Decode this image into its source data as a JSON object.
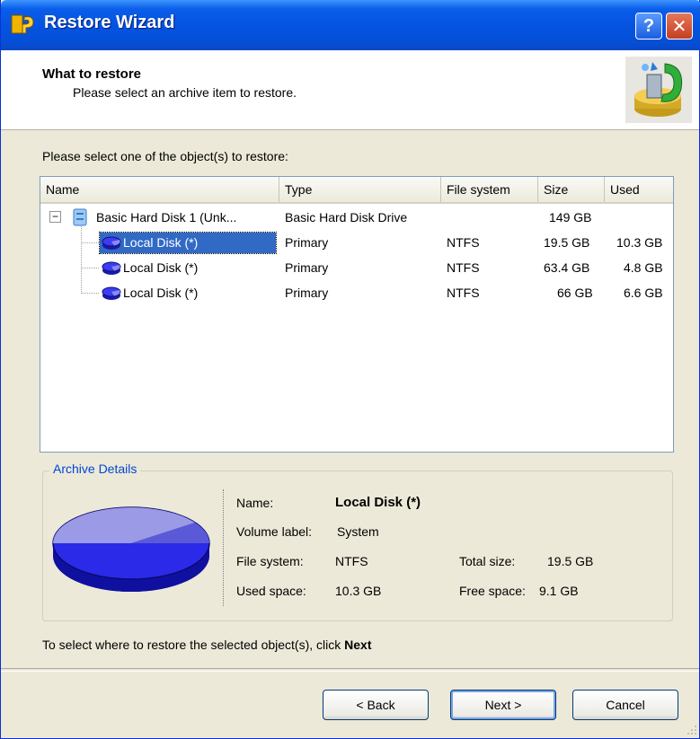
{
  "window": {
    "title": "Restore Wizard",
    "help_glyph": "?",
    "close_glyph": "✕"
  },
  "header": {
    "title": "What to restore",
    "subtitle": "Please select an archive item to restore."
  },
  "instruction": "Please select one of the object(s) to restore:",
  "list": {
    "columns": [
      "Name",
      "Type",
      "File system",
      "Size",
      "Used"
    ],
    "expander_glyph": "−",
    "rows": [
      {
        "name": "Basic Hard Disk 1 (Unk...",
        "type": "Basic Hard Disk Drive",
        "fs": "",
        "size": "149 GB",
        "used": ""
      },
      {
        "name": "Local Disk (*)",
        "type": "Primary",
        "fs": "NTFS",
        "size": "19.5 GB",
        "used": "10.3 GB",
        "selected": true
      },
      {
        "name": "Local Disk (*)",
        "type": "Primary",
        "fs": "NTFS",
        "size": "63.4 GB",
        "used": "4.8 GB"
      },
      {
        "name": "Local Disk (*)",
        "type": "Primary",
        "fs": "NTFS",
        "size": "66 GB",
        "used": "6.6 GB"
      }
    ]
  },
  "details": {
    "legend": "Archive Details",
    "name_label": "Name:",
    "name_value": "Local Disk (*)",
    "volume_label": "Volume label:",
    "volume_value": "System",
    "fs_label": "File system:",
    "fs_value": "NTFS",
    "total_label": "Total size:",
    "total_value": "19.5 GB",
    "used_label": "Used space:",
    "used_value": "10.3 GB",
    "free_label": "Free space:",
    "free_value": "9.1 GB"
  },
  "bottom_instruction": {
    "text": "To select where to restore the selected object(s), click ",
    "bold": "Next"
  },
  "buttons": {
    "back": "< Back",
    "next": "Next >",
    "cancel": "Cancel"
  },
  "colors": {
    "titlebar": "#0553e1",
    "selection": "#316ac5",
    "legend": "#0046d5"
  }
}
